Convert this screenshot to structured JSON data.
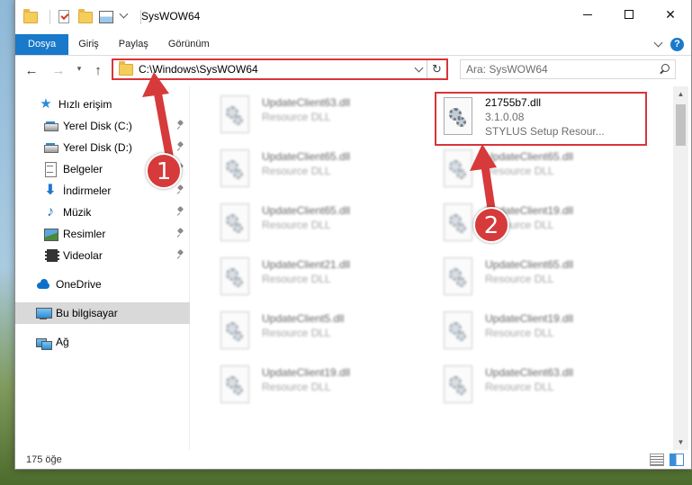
{
  "window": {
    "title": "SysWOW64",
    "controls": {
      "minimize": "",
      "maximize": "",
      "close": "✕"
    }
  },
  "ribbon": {
    "tabs": [
      "Dosya",
      "Giriş",
      "Paylaş",
      "Görünüm"
    ],
    "help_label": "?"
  },
  "navigation": {
    "back": "←",
    "forward": "→",
    "recent": "▾",
    "up": "↑",
    "address": "C:\\Windows\\SysWOW64",
    "refresh": "↻",
    "search_placeholder": "Ara: SysWOW64"
  },
  "sidebar": {
    "items": [
      {
        "label": "Hızlı erişim",
        "icon": "star-icon",
        "pinned": false,
        "selected": false
      },
      {
        "label": "Yerel Disk (C:)",
        "icon": "disk-icon",
        "pinned": true,
        "selected": false
      },
      {
        "label": "Yerel Disk (D:)",
        "icon": "disk-icon",
        "pinned": true,
        "selected": false
      },
      {
        "label": "Belgeler",
        "icon": "document-icon",
        "pinned": true,
        "selected": false
      },
      {
        "label": "İndirmeler",
        "icon": "download-icon",
        "pinned": true,
        "selected": false
      },
      {
        "label": "Müzik",
        "icon": "music-icon",
        "pinned": true,
        "selected": false
      },
      {
        "label": "Resimler",
        "icon": "pictures-icon",
        "pinned": true,
        "selected": false
      },
      {
        "label": "Videolar",
        "icon": "video-icon",
        "pinned": true,
        "selected": false
      },
      {
        "label": "OneDrive",
        "icon": "cloud-icon",
        "pinned": false,
        "selected": false
      },
      {
        "label": "Bu bilgisayar",
        "icon": "computer-icon",
        "pinned": false,
        "selected": true
      },
      {
        "label": "Ağ",
        "icon": "network-icon",
        "pinned": false,
        "selected": false
      }
    ]
  },
  "files": [
    {
      "name": "UpdateClient63.dll",
      "line2": "Resource DLL",
      "line3": "",
      "highlighted": false
    },
    {
      "name": "21755b7.dll",
      "line2": "3.1.0.08",
      "line3": "STYLUS Setup Resour...",
      "highlighted": true
    },
    {
      "name": "UpdateClient65.dll",
      "line2": "Resource DLL",
      "line3": "",
      "highlighted": false
    },
    {
      "name": "UpdateClient65.dll",
      "line2": "Resource DLL",
      "line3": "",
      "highlighted": false
    },
    {
      "name": "UpdateClient65.dll",
      "line2": "Resource DLL",
      "line3": "",
      "highlighted": false
    },
    {
      "name": "UpdateClient19.dll",
      "line2": "Resource DLL",
      "line3": "",
      "highlighted": false
    },
    {
      "name": "UpdateClient21.dll",
      "line2": "Resource DLL",
      "line3": "",
      "highlighted": false
    },
    {
      "name": "UpdateClient65.dll",
      "line2": "Resource DLL",
      "line3": "",
      "highlighted": false
    },
    {
      "name": "UpdateClient5.dll",
      "line2": "Resource DLL",
      "line3": "",
      "highlighted": false
    },
    {
      "name": "UpdateClient19.dll",
      "line2": "Resource DLL",
      "line3": "",
      "highlighted": false
    },
    {
      "name": "UpdateClient19.dll",
      "line2": "Resource DLL",
      "line3": "",
      "highlighted": false
    },
    {
      "name": "UpdateClient63.dll",
      "line2": "Resource DLL",
      "line3": "",
      "highlighted": false
    }
  ],
  "status": {
    "item_count": "175 öğe"
  },
  "annotations": {
    "step1": "1",
    "step2": "2",
    "color": "#d63a3a"
  },
  "colors": {
    "accent": "#1979ca",
    "highlight": "#d8353a"
  }
}
